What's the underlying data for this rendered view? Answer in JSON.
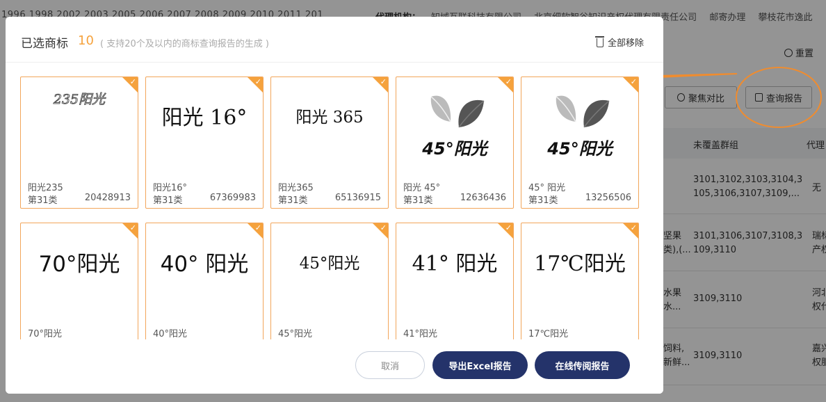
{
  "background": {
    "years": "1996  1998  2002  2003  2005  2006  2007  2008  2009  2010  2011  201",
    "agency_label": "代理机构：",
    "agency_items": [
      "知域互联科技有限公司",
      "北京细软智谷知识产权代理有限责任公司",
      "邮寄办理",
      "攀枝花市逸此"
    ],
    "reset_label": "重置",
    "compare_label": "聚焦对比",
    "report_label": "查询报告",
    "columns": [
      "未覆盖群组",
      "代理"
    ],
    "rows": [
      {
        "goods": "",
        "groups": [
          "3101,3102,3103,3104,3",
          "105,3106,3107,3109,..."
        ],
        "agent": [
          "无"
        ]
      },
      {
        "goods": "坚果",
        "goods2": "类),(...",
        "groups": [
          "3101,3106,3107,3108,3",
          "109,3110"
        ],
        "agent": [
          "瑞标",
          "产权"
        ]
      },
      {
        "goods": "水果",
        "goods2": "水...",
        "groups": [
          "3109,3110"
        ],
        "agent": [
          "河北",
          "权代"
        ]
      },
      {
        "goods": "饲料,",
        "goods2": "新鲜...",
        "groups": [
          "3109,3110"
        ],
        "agent": [
          "嘉兴",
          "权服"
        ]
      }
    ]
  },
  "modal": {
    "title": "已选商标",
    "count": "10",
    "hint": "( 支持20个及以内的商标查询报告的生成 )",
    "remove_all": "全部移除",
    "cards": [
      {
        "logo_text": "235阳光",
        "logo_style": "outline-small",
        "name": "阳光235",
        "class": "第31类",
        "reg_no": "20428913"
      },
      {
        "logo_text": "阳光 16°",
        "logo_style": "serif",
        "name": "阳光16°",
        "class": "第31类",
        "reg_no": "67369983"
      },
      {
        "logo_text": "阳光 365",
        "logo_style": "serif-small",
        "name": "阳光365",
        "class": "第31类",
        "reg_no": "65136915"
      },
      {
        "logo_text": "45°阳光",
        "logo_style": "leaf",
        "name": "阳光 45°",
        "class": "第31类",
        "reg_no": "12636436"
      },
      {
        "logo_text": "45°阳光",
        "logo_style": "leaf",
        "name": "45° 阳光",
        "class": "第31类",
        "reg_no": "13256506"
      },
      {
        "logo_text": "70°阳光",
        "logo_style": "sans-big",
        "name": "70°阳光",
        "class": "",
        "reg_no": ""
      },
      {
        "logo_text": "40°  阳光",
        "logo_style": "sans-big",
        "name": "40°阳光",
        "class": "",
        "reg_no": ""
      },
      {
        "logo_text": "45°阳光",
        "logo_style": "serif-small",
        "name": "45°阳光",
        "class": "",
        "reg_no": ""
      },
      {
        "logo_text": "41°  阳光",
        "logo_style": "serif",
        "name": "41°阳光",
        "class": "",
        "reg_no": ""
      },
      {
        "logo_text": "17℃阳光",
        "logo_style": "serif",
        "name": "17℃阳光",
        "class": "",
        "reg_no": ""
      }
    ],
    "buttons": {
      "cancel": "取消",
      "export_excel": "导出Excel报告",
      "online_report": "在线传阅报告"
    }
  },
  "colors": {
    "accent_orange": "#f5a23d",
    "primary_navy": "#24336a"
  }
}
